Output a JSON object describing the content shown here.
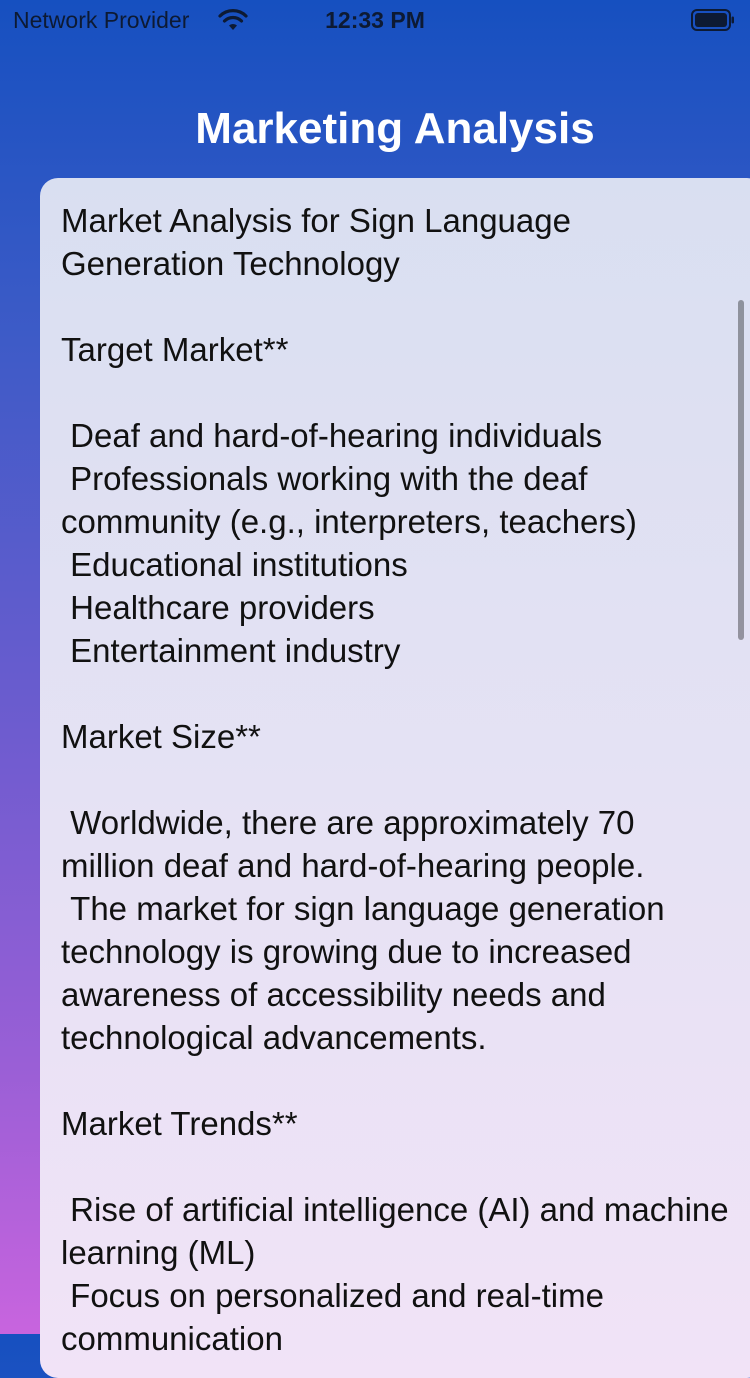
{
  "status_bar": {
    "carrier": "Network Provider",
    "time": "12:33 PM",
    "icons": [
      "wifi-icon",
      "battery-icon"
    ]
  },
  "header": {
    "title": "Marketing Analysis"
  },
  "content": {
    "text": "Market Analysis for Sign Language Generation Technology\n\nTarget Market**\n\n Deaf and hard-of-hearing individuals\n Professionals working with the deaf community (e.g., interpreters, teachers)\n Educational institutions\n Healthcare providers\n Entertainment industry\n\nMarket Size**\n\n Worldwide, there are approximately 70 million deaf and hard-of-hearing people.\n The market for sign language generation technology is growing due to increased awareness of accessibility needs and technological advancements.\n\nMarket Trends**\n\n Rise of artificial intelligence (AI) and machine learning (ML)\n Focus on personalized and real-time communication"
  }
}
